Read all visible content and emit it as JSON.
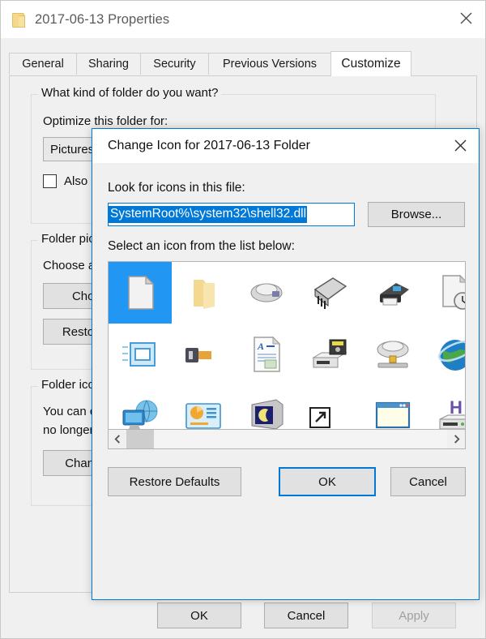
{
  "properties_window": {
    "title": "2017-06-13 Properties",
    "title_icon": "folder-icon",
    "close_icon": "close-icon",
    "tabs": [
      {
        "label": "General",
        "active": false
      },
      {
        "label": "Sharing",
        "active": false
      },
      {
        "label": "Security",
        "active": false
      },
      {
        "label": "Previous Versions",
        "active": false
      },
      {
        "label": "Customize",
        "active": true
      }
    ],
    "group_folder_kind": {
      "title": "What kind of folder do you want?",
      "label": "Optimize this folder for:",
      "combo_value": "Pictures",
      "checkbox_label": "Also apply this template to all subfolders"
    },
    "group_folder_pictures": {
      "title": "Folder pictures",
      "label": "Choose a file to show on this folder icon.",
      "choose_button": "Choose File",
      "restore_button": "Restore Default"
    },
    "group_folder_icons": {
      "title": "Folder icons",
      "line1": "You can change the folder icon. If you change the icon, it will",
      "line2": "no longer show a preview of the folder's contents.",
      "change_button": "Change Icon..."
    },
    "footer": {
      "ok": "OK",
      "cancel": "Cancel",
      "apply": "Apply",
      "apply_disabled": true
    }
  },
  "change_icon_dialog": {
    "title": "Change Icon for 2017-06-13 Folder",
    "close_icon": "close-icon",
    "look_label": "Look for icons in this file:",
    "path_value": "SystemRoot%\\system32\\shell32.dll",
    "path_full_value": "%SystemRoot%\\system32\\shell32.dll",
    "path_selected": true,
    "browse_button": "Browse...",
    "select_label": "Select an icon from the list below:",
    "scrollbar": {
      "left_arrow_icon": "chevron-left-icon",
      "right_arrow_icon": "chevron-right-icon",
      "thumb_position_percent": 0
    },
    "buttons": {
      "restore_defaults": "Restore Defaults",
      "ok": "OK",
      "cancel": "Cancel",
      "focused": "ok"
    },
    "selection_color": "#2196f3",
    "accent_color": "#0078d7",
    "icons": [
      {
        "name": "blank-document-icon",
        "selected": true
      },
      {
        "name": "folder-icon",
        "selected": false
      },
      {
        "name": "floppy-drive-icon",
        "selected": false
      },
      {
        "name": "memory-chip-icon",
        "selected": false
      },
      {
        "name": "printer-icon",
        "selected": false
      },
      {
        "name": "document-clock-icon",
        "selected": false
      },
      {
        "name": "stacked-windows-icon",
        "selected": false
      },
      {
        "name": "plug-connector-icon",
        "selected": false
      },
      {
        "name": "text-document-icon",
        "selected": false
      },
      {
        "name": "drive-card-reader-icon",
        "selected": false
      },
      {
        "name": "network-drive-icon",
        "selected": false
      },
      {
        "name": "globe-icon",
        "selected": false
      },
      {
        "name": "network-monitor-globe-icon",
        "selected": false
      },
      {
        "name": "dashboard-chart-icon",
        "selected": false
      },
      {
        "name": "monitor-moon-icon",
        "selected": false
      },
      {
        "name": "shortcut-overlay-icon",
        "selected": false
      },
      {
        "name": "window-icon",
        "selected": false
      },
      {
        "name": "drive-letter-h-icon",
        "selected": false
      },
      {
        "name": "disconnected-drive-icon",
        "selected": false
      },
      {
        "name": "internet-globe-mouse-icon",
        "selected": false
      },
      {
        "name": "network-nodes-icon",
        "selected": false
      },
      {
        "name": "search-magnifier-icon",
        "selected": false
      },
      {
        "name": "drive-back-arrow-icon",
        "selected": false
      },
      {
        "name": "clock-overlay-icon",
        "selected": false
      },
      {
        "name": "folder-open-icon",
        "selected": false
      },
      {
        "name": "hard-drive-icon",
        "selected": false
      },
      {
        "name": "optical-cd-drive-icon",
        "selected": false
      },
      {
        "name": "computer-keyboard-icon",
        "selected": false
      },
      {
        "name": "folder-grid-icon",
        "selected": false
      },
      {
        "name": "help-question-icon",
        "selected": false
      },
      {
        "name": "power-button-icon",
        "selected": false
      },
      {
        "name": "recycle-bin-icon",
        "selected": false
      }
    ]
  }
}
